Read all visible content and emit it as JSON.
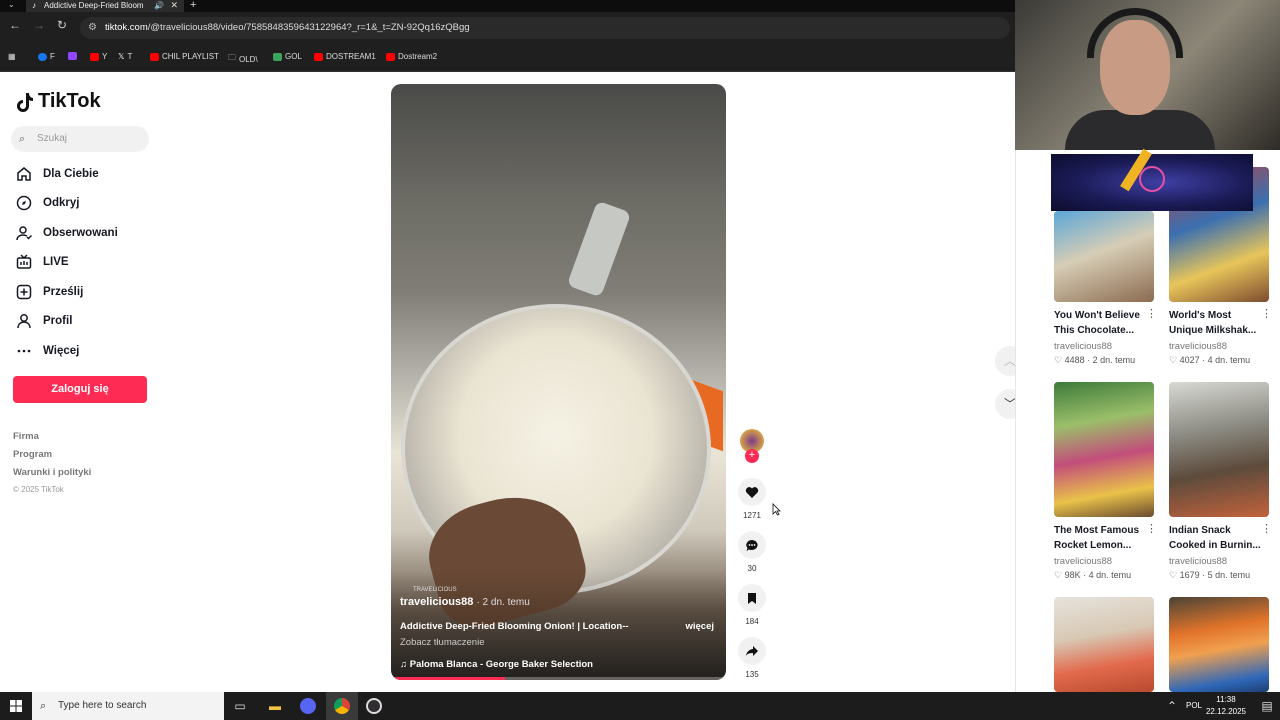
{
  "browser": {
    "tab_title": "Addictive Deep-Fried Bloom",
    "url_host": "tiktok.com",
    "url_path": "/@travelicious88/video/7585848359643122964?_r=1&_t=ZN-92Qq16zQBgg",
    "bookmarks": [
      "F",
      "Y",
      "T",
      "CHIL PLAYLIST",
      "OLD\\",
      "GOL",
      "DOSTREAM1",
      "Dostream2"
    ]
  },
  "sidebar": {
    "logo": "TikTok",
    "search_placeholder": "Szukaj",
    "items": [
      {
        "label": "Dla Ciebie",
        "icon": "home-icon"
      },
      {
        "label": "Odkryj",
        "icon": "compass-icon"
      },
      {
        "label": "Obserwowani",
        "icon": "following-icon"
      },
      {
        "label": "LIVE",
        "icon": "live-icon"
      },
      {
        "label": "Prześlij",
        "icon": "upload-icon"
      },
      {
        "label": "Profil",
        "icon": "profile-icon"
      },
      {
        "label": "Więcej",
        "icon": "more-icon"
      }
    ],
    "login_button": "Zaloguj się",
    "footer_links": [
      "Firma",
      "Program",
      "Warunki i polityki"
    ],
    "copyright": "© 2025 TikTok"
  },
  "video": {
    "watermark": "TRAVELICIOUS",
    "author": "travelicious88",
    "time_ago": "· 2 dn. temu",
    "description": "Addictive Deep-Fried Blooming Onion! | Location--",
    "more": "więcej",
    "translate": "Zobacz tłumaczenie",
    "music": "Paloma Blanca - George Baker Selection"
  },
  "actions": {
    "likes": "1271",
    "comments": "30",
    "saves": "184",
    "shares": "135"
  },
  "recommended": [
    {
      "title_line1": "You Won't Believe",
      "title_line2": "This Chocolate...",
      "user": "travelicious88",
      "likes": "4488",
      "time": "2 dn. temu"
    },
    {
      "title_line1": "World's Most",
      "title_line2": "Unique Milkshak...",
      "user": "travelicious88",
      "likes": "4027",
      "time": "4 dn. temu"
    },
    {
      "title_line1": "The Most Famous",
      "title_line2": "Rocket Lemon...",
      "user": "travelicious88",
      "likes": "98K",
      "time": "4 dn. temu"
    },
    {
      "title_line1": "Indian Snack",
      "title_line2": "Cooked in Burnin...",
      "user": "travelicious88",
      "likes": "1679",
      "time": "5 dn. temu"
    }
  ],
  "taskbar": {
    "search_placeholder": "Type here to search",
    "language": "POL",
    "time": "11:38",
    "date": "22.12.2025"
  },
  "colors": {
    "accent": "#fe2c55",
    "text": "#161823"
  }
}
